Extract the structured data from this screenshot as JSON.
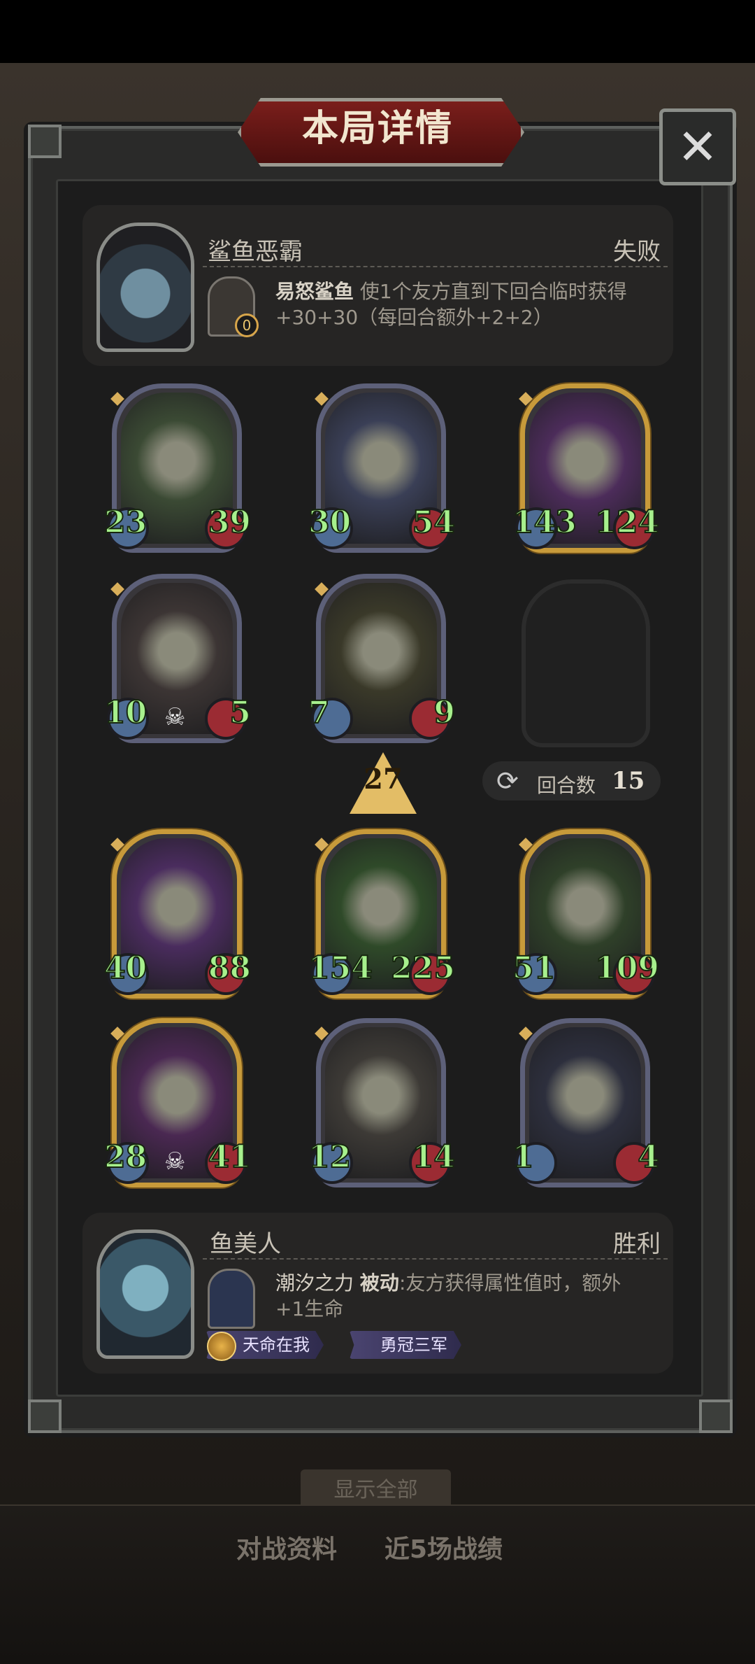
{
  "window": {
    "title": "本局详情",
    "close_icon": "close-icon"
  },
  "opponent": {
    "name": "鲨鱼恶霸",
    "result": "失败",
    "skill_name": "易怒鲨鱼",
    "skill_desc_line1": "使1个友方直到下回合临时获得",
    "skill_desc_line2": "+30+30（每回合额外+2+2）",
    "skill_badge_value": "0"
  },
  "opponent_board": [
    {
      "attack": "23",
      "health": "39",
      "frame": "normal",
      "art": "#3b4a34"
    },
    {
      "attack": "30",
      "health": "54",
      "frame": "normal",
      "art": "#3a3f56"
    },
    {
      "attack": "143",
      "health": "124",
      "frame": "gold",
      "art": "#4c2c5a"
    },
    {
      "attack": "10",
      "health": "5",
      "frame": "normal",
      "art": "#3c3534",
      "skull": true
    },
    {
      "attack": "7",
      "health": "9",
      "frame": "normal",
      "art": "#3a3929"
    }
  ],
  "tavern_level": "27",
  "round": {
    "label": "回合数",
    "value": "15"
  },
  "player_board": [
    {
      "attack": "40",
      "health": "88",
      "frame": "gold",
      "art": "#4a2c5e"
    },
    {
      "attack": "154",
      "health": "225",
      "frame": "gold",
      "art": "#2f4a29"
    },
    {
      "attack": "51",
      "health": "109",
      "frame": "gold",
      "art": "#2f4029"
    },
    {
      "attack": "28",
      "health": "41",
      "frame": "gold",
      "art": "#4a2852",
      "skull": true
    },
    {
      "attack": "12",
      "health": "14",
      "frame": "normal",
      "art": "#3d3a36"
    },
    {
      "attack": "1",
      "health": "4",
      "frame": "normal",
      "art": "#2d2f3d"
    }
  ],
  "player": {
    "name": "鱼美人",
    "result": "胜利",
    "skill_name": "潮汐之力",
    "skill_tag": "被动",
    "skill_desc_line1": ":友方获得属性值时，额外",
    "skill_desc_line2": "+1生命",
    "badges": [
      "天命在我",
      "勇冠三军"
    ]
  },
  "footer": {
    "show_all": "显示全部",
    "tab1": "对战资料",
    "tab2": "近5场战绩"
  }
}
